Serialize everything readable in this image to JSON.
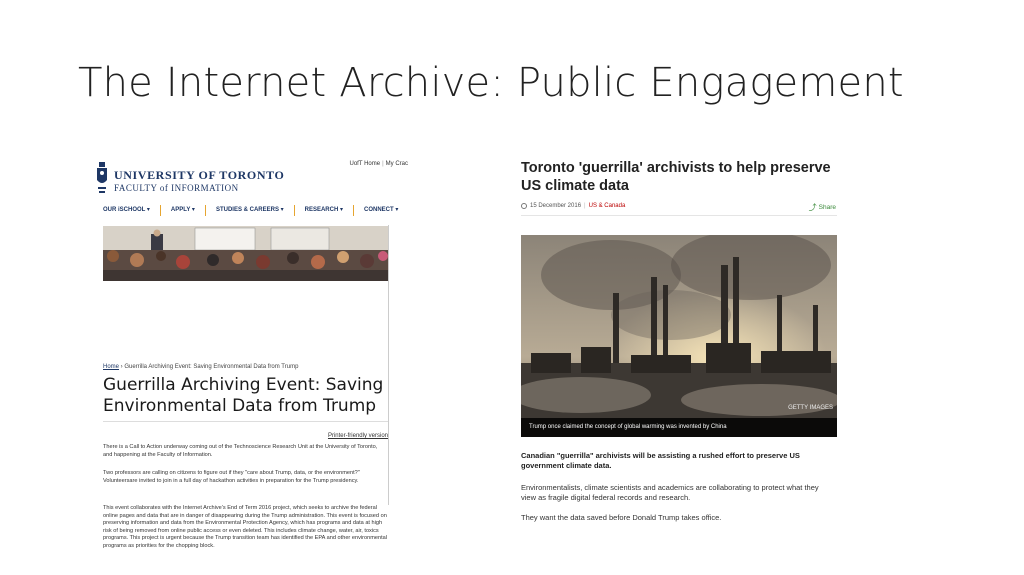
{
  "slide": {
    "title": "The Internet Archive:  Public Engagement"
  },
  "uoft": {
    "top_links": [
      "UofT Home",
      "My Crac"
    ],
    "name_line1": "UNIVERSITY OF TORONTO",
    "name_line2": "FACULTY of INFORMATION",
    "nav": [
      {
        "label": "OUR iSCHOOL ▾"
      },
      {
        "label": "APPLY ▾"
      },
      {
        "label": "STUDIES & CAREERS ▾"
      },
      {
        "label": "RESEARCH ▾"
      },
      {
        "label": "CONNECT ▾"
      }
    ],
    "breadcrumb_home": "Home",
    "breadcrumb_rest": " › Guerrilla Archiving Event: Saving Environmental Data from Trump",
    "article_title": "Guerrilla Archiving Event: Saving Environmental Data from Trump",
    "printer_link": "Printer-friendly version",
    "paragraphs": [
      "There is a Call to Action underway coming out of the Technoscience Research Unit at the University of Toronto, and happening at the Faculty of Information.",
      "Two professors are calling on citizens to figure out if they \"care about Trump, data, or the environment?\" Volunteersare invited to join in a full day of hackathon activities in preparation for the Trump presidency.",
      "This event collaborates with the Internet Archive's End of Term 2016 project, which seeks to archive the federal online pages and data that are in danger of disappearing during the Trump administration. This event is focused on preserving information and data from the Environmental Protection Agency, which has programs and data at high risk of being removed from online public access or even deleted. This includes climate change, water, air, toxics programs. This project is urgent because the Trump transition team has identified the EPA and other environmental programs as priorities for the chopping block."
    ]
  },
  "news": {
    "headline": "Toronto 'guerrilla' archivists to help preserve US climate data",
    "date": "15 December 2016",
    "section": "US & Canada",
    "share_label": "Share",
    "photo_credit": "GETTY IMAGES",
    "photo_caption": "Trump once claimed the concept of global warming was invented by China",
    "lead": "Canadian \"guerrilla\" archivists will be assisting a rushed effort to preserve US government climate data.",
    "body": [
      "Environmentalists, climate scientists and academics are collaborating to protect what they view as fragile digital federal records and research.",
      "They want the data saved before Donald Trump takes office."
    ]
  },
  "colors": {
    "uoft_blue": "#1e3765",
    "uoft_gold": "#e6a530",
    "bbc_red": "#bb0000",
    "share_green": "#3a8a3a"
  }
}
